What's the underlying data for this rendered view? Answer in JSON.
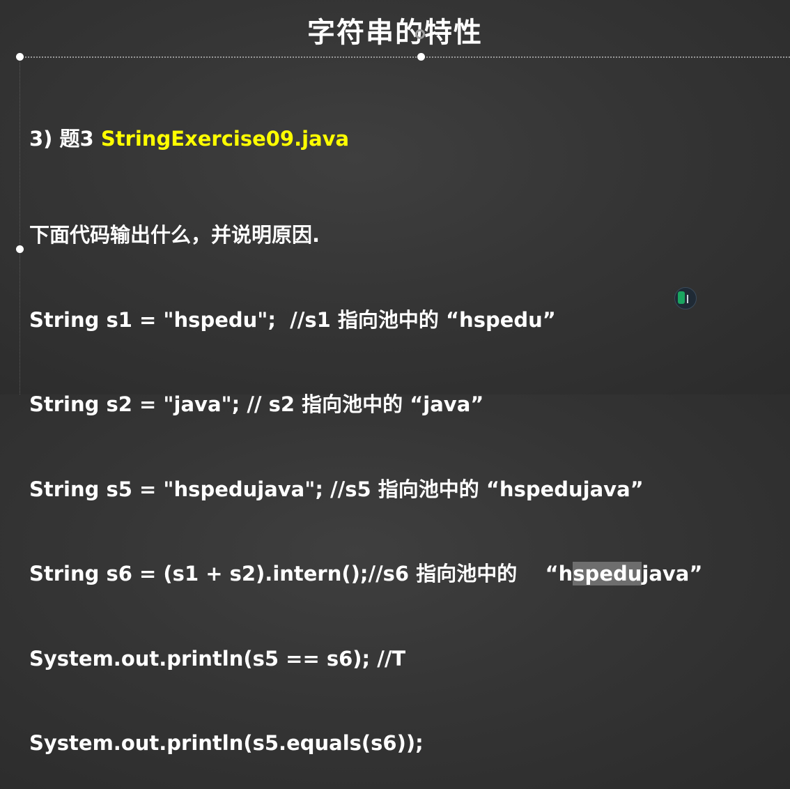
{
  "slide": {
    "title": "字符串的特性",
    "heading": {
      "prefix": "3) 题3 ",
      "file": "StringExercise09.java"
    },
    "code_lines": [
      "下面代码输出什么，并说明原因.",
      "String s1 = \"hspedu\";  //s1 指向池中的 “hspedu”",
      "String s2 = \"java\"; // s2 指向池中的 “java”",
      "String s5 = \"hspedujava\"; //s5 指向池中的 “hspedujava”",
      "System.out.println(s5 == s6); //T",
      "System.out.println(s5.equals(s6));"
    ],
    "line4": {
      "before": "String s6 = (s1 + s2).intern();//s6 指向池中的    “h",
      "selected": "spedu",
      "after": "java”"
    },
    "accent_color": "#ffff00",
    "background_color": "#353535"
  }
}
